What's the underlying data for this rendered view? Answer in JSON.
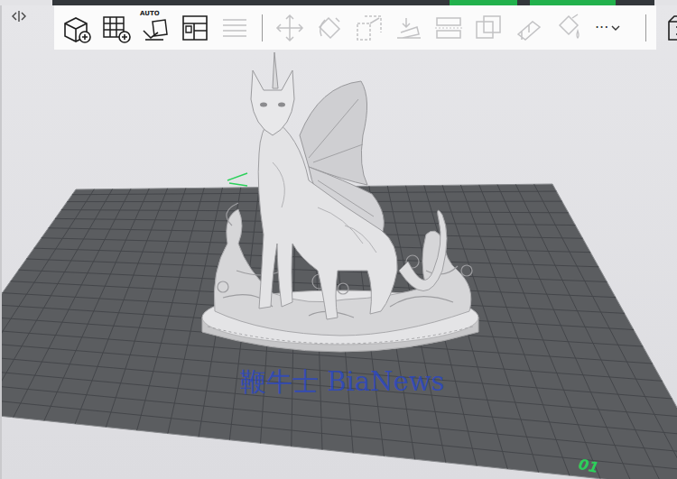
{
  "toolbar": {
    "tools": [
      {
        "disabled": false
      },
      {
        "disabled": false
      },
      {
        "label": "AUTO",
        "disabled": false
      },
      {
        "disabled": false
      },
      {
        "disabled": true
      },
      {
        "disabled": true
      },
      {
        "disabled": true
      },
      {
        "disabled": true
      },
      {
        "disabled": true
      },
      {
        "disabled": true
      },
      {
        "disabled": true
      },
      {
        "disabled": true
      },
      {
        "disabled": true
      }
    ],
    "more": {
      "label": "···",
      "disabled": false
    },
    "end_tool": {
      "disabled": false
    }
  },
  "plate": {
    "label": "01"
  },
  "watermark": "鞭牛士 BiaNews"
}
